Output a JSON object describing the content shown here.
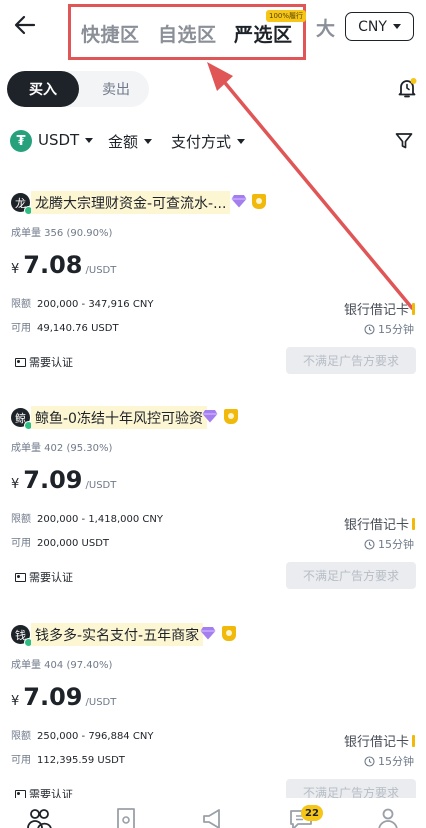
{
  "header": {
    "tabs": [
      {
        "label": "快捷区",
        "active": false
      },
      {
        "label": "自选区",
        "active": false
      },
      {
        "label": "严选区",
        "active": true
      }
    ],
    "badge": "100%履行",
    "more_tab": "大",
    "currency": "CNY"
  },
  "toggle": {
    "buy": "买入",
    "sell": "卖出"
  },
  "filters": {
    "coin_symbol": "₮",
    "coin": "USDT",
    "amount": "金额",
    "payment": "支付方式"
  },
  "ads": [
    {
      "avatar": "龙",
      "merchant": "龙腾大宗理财资金-可查流水-...",
      "orders": "成单量 356 (90.90%)",
      "currency_symbol": "¥",
      "price": "7.08",
      "unit": "/USDT",
      "limit_label": "限额",
      "limit": "200,000 - 347,916 CNY",
      "avail_label": "可用",
      "avail": "49,140.76 USDT",
      "payment": "银行借记卡",
      "time": "15分钟",
      "verify": "需要认证",
      "button": "不满足广告方要求"
    },
    {
      "avatar": "鲸",
      "merchant": "鲸鱼-0冻结十年风控可验资",
      "orders": "成单量 402 (95.30%)",
      "currency_symbol": "¥",
      "price": "7.09",
      "unit": "/USDT",
      "limit_label": "限额",
      "limit": "200,000 - 1,418,000 CNY",
      "avail_label": "可用",
      "avail": "200,000 USDT",
      "payment": "银行借记卡",
      "time": "15分钟",
      "verify": "需要认证",
      "button": "不满足广告方要求"
    },
    {
      "avatar": "钱",
      "merchant": "钱多多-实名支付-五年商家",
      "orders": "成单量 404 (97.40%)",
      "currency_symbol": "¥",
      "price": "7.09",
      "unit": "/USDT",
      "limit_label": "限额",
      "limit": "250,000 - 796,884 CNY",
      "avail_label": "可用",
      "avail": "112,395.59 USDT",
      "payment": "银行借记卡",
      "time": "15分钟",
      "verify": "需要认证",
      "button": "不满足广告方要求"
    }
  ],
  "bottom_nav": {
    "messages_badge": "22"
  },
  "colors": {
    "highlight_box": "#e05555",
    "accent": "#f0b90b",
    "dark": "#1e2329",
    "online": "#2ebd85"
  }
}
